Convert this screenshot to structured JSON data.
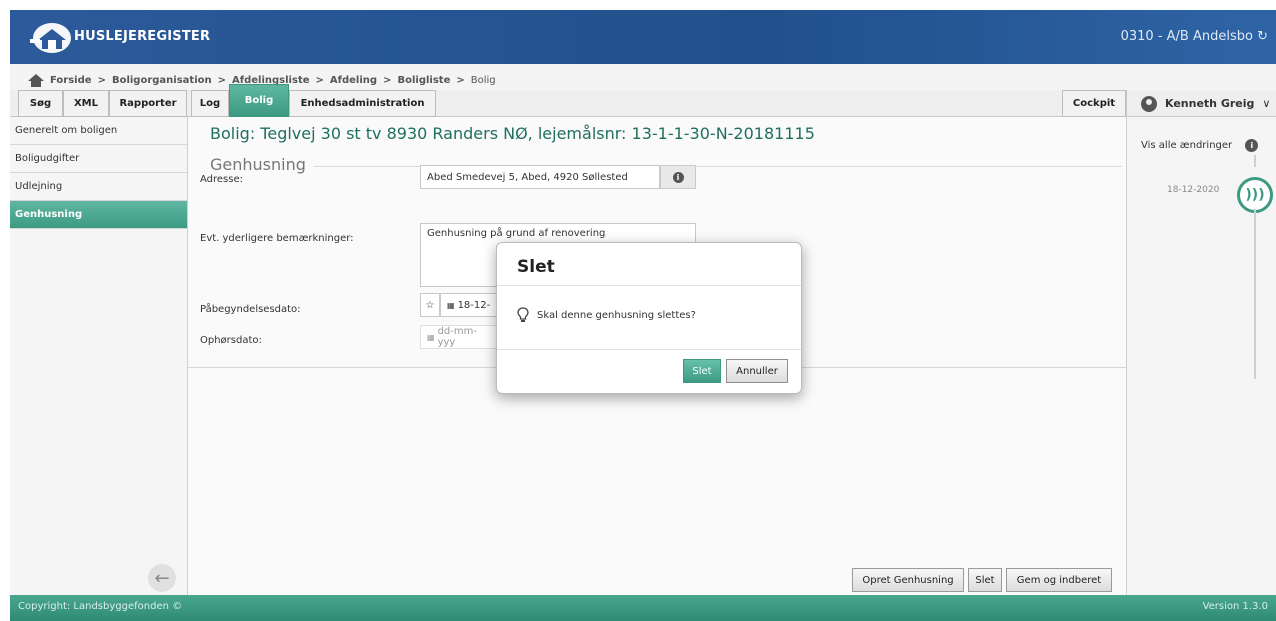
{
  "header": {
    "logo_text": "HUSLEJEREGISTER",
    "organization": "0310 - A/B Andelsbo"
  },
  "breadcrumb": {
    "items": [
      "Forside",
      "Boligorganisation",
      "Afdelingsliste",
      "Afdeling",
      "Boligliste",
      "Bolig"
    ],
    "separator": ">"
  },
  "tabs": [
    "Søg",
    "XML",
    "Rapporter",
    "Log",
    "Bolig",
    "Enhedsadministration",
    "Cockpit"
  ],
  "active_tab": "Bolig",
  "user": {
    "name": "Kenneth Greig"
  },
  "sidebar": {
    "items": [
      "Generelt om boligen",
      "Boligudgifter",
      "Udlejning",
      "Genhusning"
    ],
    "active": "Genhusning"
  },
  "main": {
    "title": "Bolig: Teglvej 30 st tv 8930 Randers NØ, lejemålsnr: 13-1-1-30-N-20181115",
    "section": "Genhusning",
    "fields": {
      "adresse_label": "Adresse:",
      "adresse_value": "Abed Smedevej 5, Abed, 4920 Søllested",
      "bemaerk_label": "Evt. yderligere bemærkninger:",
      "bemaerk_value": "Genhusning på grund af renovering",
      "start_label": "Påbegyndelsesdato:",
      "start_value": "18-12-",
      "end_label": "Ophørsdato:",
      "end_placeholder": "dd-mm-yyy"
    },
    "buttons": {
      "opret": "Opret Genhusning",
      "slet": "Slet",
      "gem": "Gem og indberet"
    }
  },
  "right_panel": {
    "show_all": "Vis alle ændringer",
    "timeline_date": "18-12-2020"
  },
  "footer": {
    "copyright": "Copyright: Landsbyggefonden ©",
    "version": "Version 1.3.0"
  },
  "modal": {
    "title": "Slet",
    "message": "Skal denne genhusning slettes?",
    "confirm": "Slet",
    "cancel": "Annuller"
  },
  "colors": {
    "header_blue": "#21508c",
    "accent_green": "#3d9a82"
  }
}
